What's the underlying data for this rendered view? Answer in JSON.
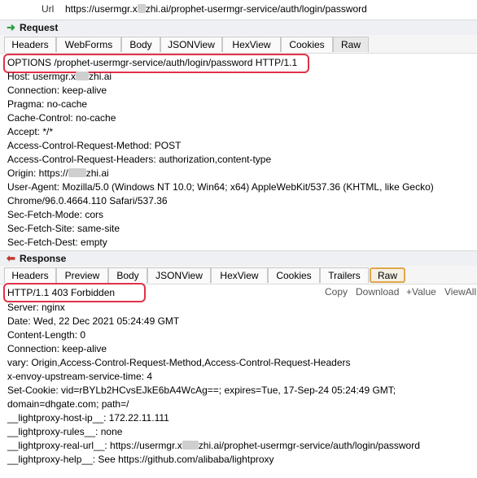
{
  "url": {
    "label": "Url",
    "prefix": "https://usermgr.x",
    "suffix": "zhi.ai/prophet-usermgr-service/auth/login/password"
  },
  "request": {
    "title": "Request",
    "tabs": [
      "Headers",
      "WebForms",
      "Body",
      "JSONView",
      "HexView",
      "Cookies",
      "Raw"
    ],
    "active_tab": "Raw",
    "request_line": "OPTIONS /prophet-usermgr-service/auth/login/password HTTP/1.1",
    "host_prefix": "Host: usermgr.x",
    "host_suffix": "zhi.ai",
    "lines_a": [
      "Connection: keep-alive",
      "Pragma: no-cache",
      "Cache-Control: no-cache",
      "Accept: */*",
      "Access-Control-Request-Method: POST",
      "Access-Control-Request-Headers: authorization,content-type"
    ],
    "origin_prefix": "Origin: https://",
    "origin_suffix": "zhi.ai",
    "lines_b": [
      "User-Agent: Mozilla/5.0 (Windows NT 10.0; Win64; x64) AppleWebKit/537.36 (KHTML, like Gecko)",
      "Chrome/96.0.4664.110 Safari/537.36",
      "Sec-Fetch-Mode: cors",
      "Sec-Fetch-Site: same-site",
      "Sec-Fetch-Dest: empty"
    ]
  },
  "response": {
    "title": "Response",
    "tabs": [
      "Headers",
      "Preview",
      "Body",
      "JSONView",
      "HexView",
      "Cookies",
      "Trailers",
      "Raw"
    ],
    "active_tab": "Raw",
    "toolbar": [
      "Copy",
      "Download",
      "+Value",
      "ViewAll"
    ],
    "status_line": "HTTP/1.1 403 Forbidden",
    "lines": [
      "Server: nginx",
      "Date: Wed, 22 Dec 2021 05:24:49 GMT",
      "Content-Length: 0",
      "Connection: keep-alive",
      "vary: Origin,Access-Control-Request-Method,Access-Control-Request-Headers",
      "x-envoy-upstream-service-time: 4",
      "Set-Cookie: vid=rBYLb2HCvsEJkE6bA4WcAg==; expires=Tue, 17-Sep-24 05:24:49 GMT;",
      "domain=dhgate.com; path=/",
      "__lightproxy-host-ip__: 172.22.11.111",
      "__lightproxy-rules__: none"
    ],
    "real_url_prefix": "__lightproxy-real-url__: https://usermgr.x",
    "real_url_suffix": "zhi.ai/prophet-usermgr-service/auth/login/password",
    "help_line": "__lightproxy-help__: See https://github.com/alibaba/lightproxy"
  },
  "colors": {
    "request_arrow": "#2e9e3e",
    "response_arrow": "#c0392b",
    "highlight_box": "#e0324a",
    "active_tab_border": "#e1a64b"
  }
}
